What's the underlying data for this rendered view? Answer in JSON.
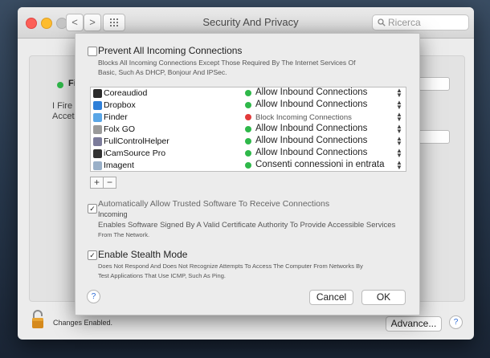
{
  "window": {
    "title": "Security And Privacy",
    "search_placeholder": "Ricerca",
    "nav_back": "<",
    "nav_forward": ">"
  },
  "background_panel": {
    "status_text": "Fi",
    "side_text_1": "I Fire",
    "side_text_2": "Accet"
  },
  "dialog": {
    "prevent": {
      "checked": false,
      "label": "Prevent All Incoming Connections",
      "desc_line1": "Blocks All Incoming Connections Except Those Required By The Internet Services Of",
      "desc_line2": "Basic, Such As DHCP, Bonjour And IPSec."
    },
    "apps": [
      {
        "name": "Coreaudiod",
        "status": "Allow Inbound Connections",
        "status_color": "#2fb84a",
        "icon_color": "#2b2b2b"
      },
      {
        "name": "Dropbox",
        "status": "Allow Inbound Connections",
        "status_color": "#2fb84a",
        "icon_color": "#2e7fd8"
      },
      {
        "name": "Finder",
        "status": "Block Incoming Connections",
        "status_color": "#e23b3b",
        "icon_color": "#5aa6e6"
      },
      {
        "name": "Folx GO",
        "status": "Allow Inbound Connections",
        "status_color": "#2fb84a",
        "icon_color": "#9a9a9a"
      },
      {
        "name": "FullControlHelper",
        "status": "Allow Inbound Connections",
        "status_color": "#2fb84a",
        "icon_color": "#7b7b9a"
      },
      {
        "name": "iCamSource Pro",
        "status": "Allow Inbound Connections",
        "status_color": "#2fb84a",
        "icon_color": "#333333"
      },
      {
        "name": "Imagent",
        "status": "Consenti connessioni in entrata",
        "status_color": "#2fb84a",
        "icon_color": "#9ab0c8"
      }
    ],
    "add_label": "+",
    "remove_label": "−",
    "auto_allow": {
      "checked": true,
      "label_line1": "Automatically Allow Trusted Software To Receive Connections",
      "label_line2": "Incoming",
      "desc_line1": "Enables Software Signed By A Valid Certificate Authority To Provide Accessible Services",
      "desc_line2": "From The Network."
    },
    "stealth": {
      "checked": true,
      "label": "Enable Stealth Mode",
      "desc_line1": "Does Not Respond And Does Not Recognize Attempts To Access The Computer From Networks By",
      "desc_line2": "Test Applications That Use ICMP, Such As Ping."
    },
    "help_label": "?",
    "cancel_label": "Cancel",
    "ok_label": "OK"
  },
  "footer": {
    "lock_text": "Changes Enabled.",
    "advanced_label": "Advance...",
    "help_label": "?"
  }
}
